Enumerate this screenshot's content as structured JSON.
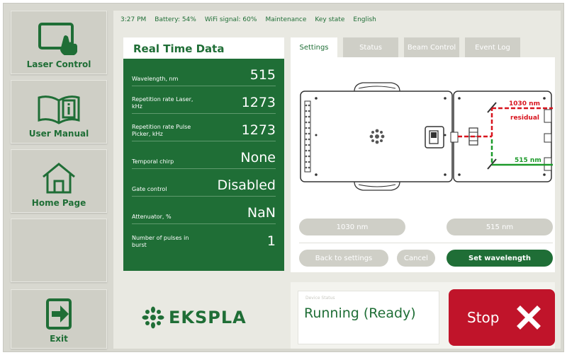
{
  "nav": {
    "laser_control": "Laser Control",
    "user_manual": "User Manual",
    "home_page": "Home Page",
    "exit": "Exit"
  },
  "status": {
    "time": "3:27 PM",
    "battery": "Battery:  54%",
    "wifi": "WiFi signal:    60%",
    "maintenance": "Maintenance",
    "key_state": "Key state",
    "language": "English"
  },
  "realtime": {
    "title": "Real Time Data",
    "rows": [
      {
        "label": "Wavelength, nm",
        "value": "515"
      },
      {
        "label": "Repetition rate Laser, kHz",
        "value": "1273"
      },
      {
        "label": "Repetition rate Pulse Picker, kHz",
        "value": "1273"
      },
      {
        "label": "Temporal chirp",
        "value": "None"
      },
      {
        "label": "Gate control",
        "value": "Disabled"
      },
      {
        "label": "Attenuator, %",
        "value": "NaN"
      },
      {
        "label": "Number of pulses in burst",
        "value": "1"
      }
    ]
  },
  "tabs": [
    "Settings",
    "Status",
    "Beam Control",
    "Event Log"
  ],
  "diagram": {
    "label_1030": "1030 nm",
    "label_residual": "residual",
    "label_515": "515 nm",
    "color_red": "#d8141e",
    "color_green": "#1c9a2a"
  },
  "buttons": {
    "wl_1030": "1030 nm",
    "wl_515": "515 nm",
    "back": "Back to settings",
    "cancel": "Cancel",
    "set_wavelength": "Set wavelength"
  },
  "brand": "EKSPLA",
  "device_status": {
    "caption": "Device Status",
    "state": "Running (Ready)"
  },
  "stop": {
    "label": "Stop",
    "icon": "close-icon"
  },
  "colors": {
    "brand_green": "#1f6e36",
    "stop_red": "#c0142a"
  }
}
